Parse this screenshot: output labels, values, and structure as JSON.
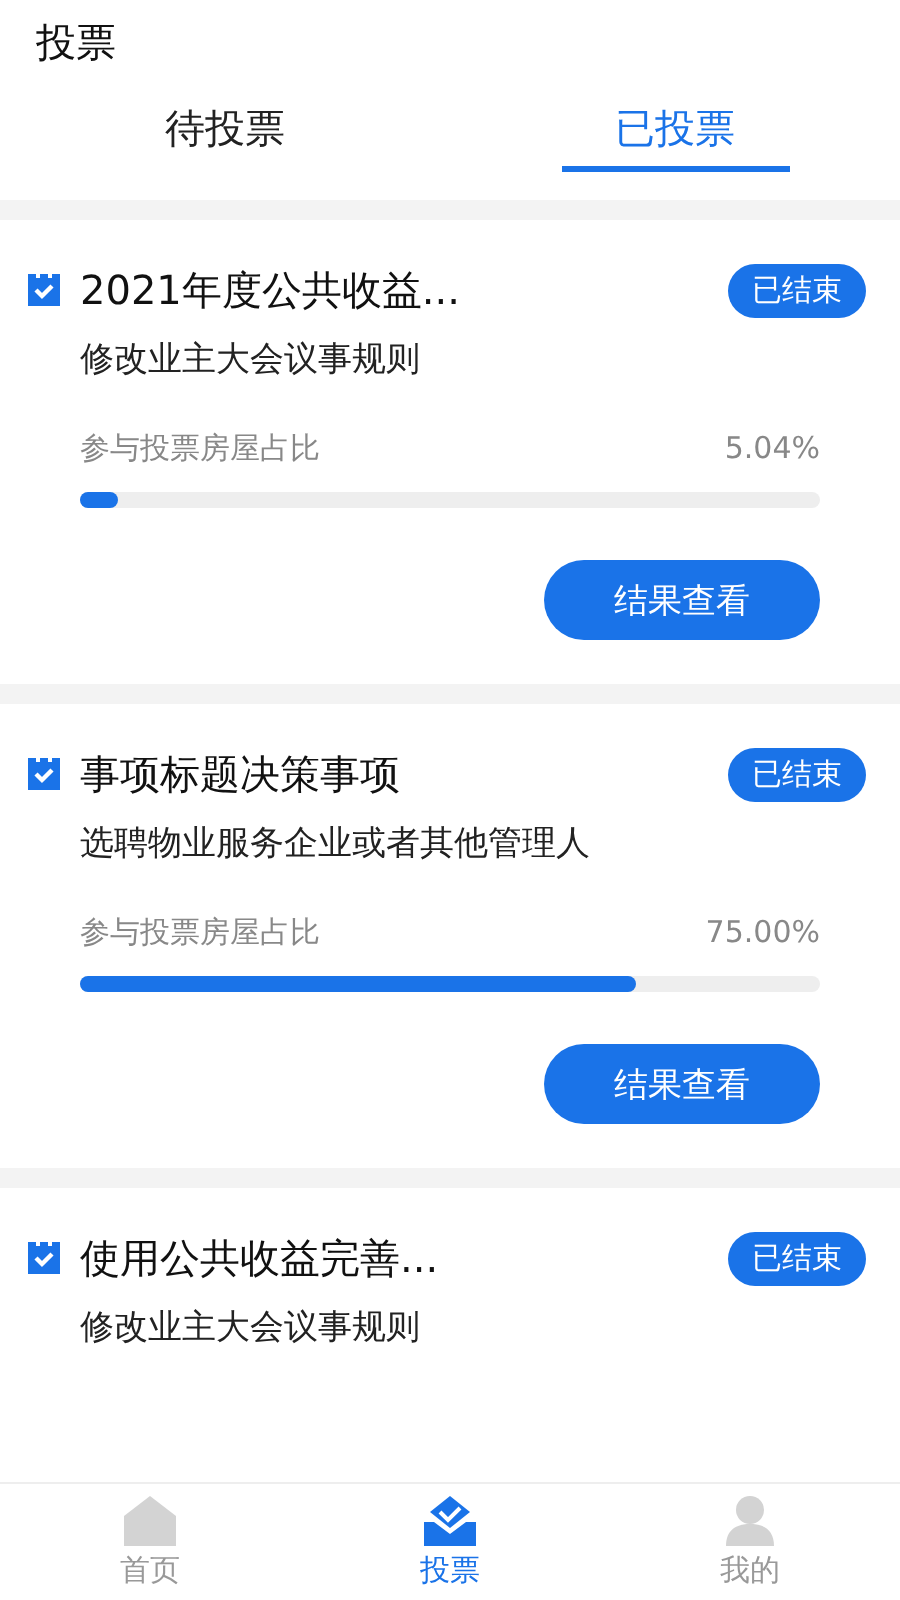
{
  "header": {
    "title": "投票"
  },
  "tabs": [
    {
      "label": "待投票",
      "selected": false
    },
    {
      "label": "已投票",
      "selected": true
    }
  ],
  "votes": [
    {
      "title": "2021年度公共收益...",
      "status": "已结束",
      "description": "修改业主大会议事规则",
      "stat_label": "参与投票房屋占比",
      "stat_value": "5.04%",
      "level": 0.05,
      "button": "结果查看"
    },
    {
      "title": "事项标题决策事项",
      "status": "已结束",
      "description": "选聘物业服务企业或者其他管理人",
      "stat_label": "参与投票房屋占比",
      "stat_value": "75.00%",
      "level": 0.75,
      "button": "结果查看"
    },
    {
      "title": "使用公共收益完善...",
      "status": "已结束",
      "description": "修改业主大会议事规则"
    }
  ],
  "bottom_nav": [
    {
      "label": "首页",
      "kind": "home",
      "selected": false
    },
    {
      "label": "投票",
      "kind": "vote",
      "selected": true
    },
    {
      "label": "我的",
      "kind": "user",
      "selected": false
    }
  ]
}
